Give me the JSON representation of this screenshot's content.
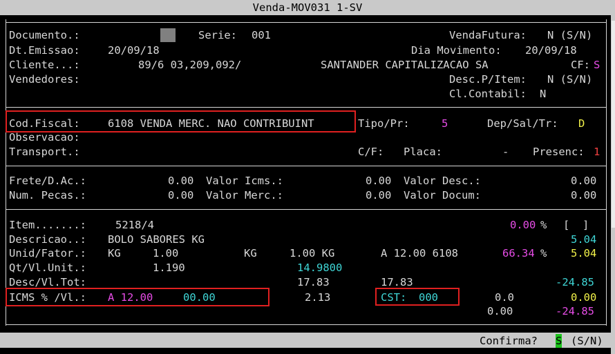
{
  "window_title": "Venda-MOV031 1-SV",
  "header": {
    "documento_label": "Documento.:",
    "serie_label": "Serie:",
    "serie_value": "001",
    "venda_futura_label": "VendaFutura:",
    "venda_futura_value": "N (S/N)",
    "dt_emissao_label": "Dt.Emissao:",
    "dt_emissao_value": "20/09/18",
    "dia_movimento_label": "Dia Movimento:",
    "dia_movimento_value": "20/09/18",
    "cliente_label": "Cliente...:",
    "cliente_code": "89/6 03,209,092/",
    "cliente_name": "SANTANDER CAPITALIZACAO SA",
    "cf_label": "CF:",
    "cf_value": "S",
    "vendedores_label": "Vendedores:",
    "desc_item_label": "Desc.P/Item:",
    "desc_item_value": "N (S/N)",
    "cl_contabil_label": "Cl.Contabil:",
    "cl_contabil_value": "N"
  },
  "fiscal": {
    "cod_fiscal_label": "Cod.Fiscal:",
    "cod_fiscal_value": "6108 VENDA MERC. NAO CONTRIBUINT",
    "tipo_pr_label": "Tipo/Pr:",
    "tipo_pr_value": "5",
    "dep_sal_tr_label": "Dep/Sal/Tr:",
    "dep_sal_tr_value": "D",
    "observacao_label": "Observacao:",
    "transport_label": "Transport.:",
    "cf_label": "C/F:",
    "placa_label": "Placa:",
    "placa_value": "-",
    "presenc_label": "Presenc:",
    "presenc_value": "1"
  },
  "totals": {
    "frete_label": "Frete/D.Ac.:",
    "frete_value": "0.00",
    "valor_icms_label": "Valor Icms.:",
    "valor_icms_value": "0.00",
    "valor_desc_label": "Valor Desc.:",
    "valor_desc_value": "0.00",
    "num_pecas_label": "Num. Pecas.:",
    "num_pecas_value": "0.00",
    "valor_merc_label": "Valor Merc.:",
    "valor_merc_value": "0.00",
    "valor_docum_label": "Valor Docum:",
    "valor_docum_value": "0.00"
  },
  "item": {
    "item_label": "Item.......:",
    "item_value": "5218/4",
    "item_pct": "0.00",
    "pct_sign": "%",
    "bracket": "[  ]",
    "descricao_label": "Descricao..:",
    "descricao_value": "BOLO SABORES KG",
    "descricao_right": "5.04",
    "unid_label": "Unid/Fator.:",
    "unid_value": "KG",
    "fator_value": "1.00",
    "unid2": "KG",
    "fator2": "1.00 KG",
    "aliq": "A 12.00 6108",
    "margin_pct": "66.34",
    "unid_right": "5.04",
    "qt_label": "Qt/Vl.Unit.:",
    "qt_value": "1.190",
    "vl_unit": "14.9800",
    "desc_label": "Desc/Vl.Tot:",
    "desc_value": "17.83",
    "vl_tot": "17.83",
    "desc_right": "-24.85",
    "icms_label": "ICMS % /Vl.:",
    "icms_value": "A 12.00",
    "icms_vl": "00.00",
    "icms_amount": "2.13",
    "cst_label": "CST:",
    "cst_value": "000",
    "cst_extra": "0.0",
    "cst_right": "0.00",
    "last_mid": "0.00",
    "last_right": "-24.85"
  },
  "footer": {
    "confirm_label": "Confirma?",
    "confirm_value": "S",
    "confirm_options": "(S/N)"
  }
}
